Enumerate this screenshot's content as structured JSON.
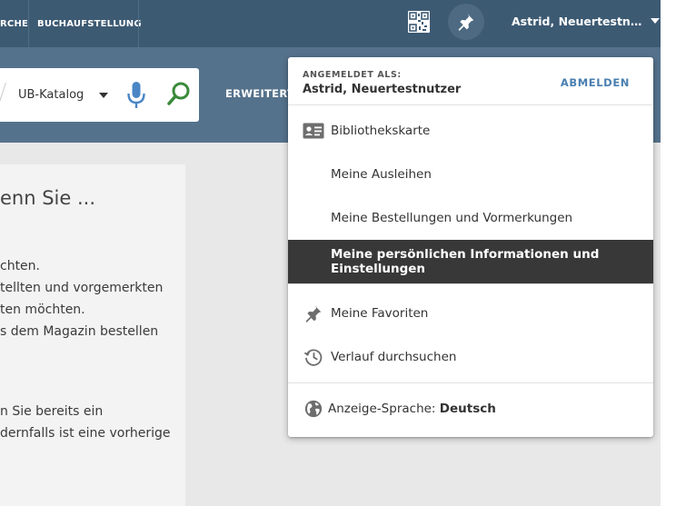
{
  "topbar": {
    "nav_partial": "RCHE",
    "nav_buchaufstellung": "BUCHAUFSTELLUNG",
    "user_name_truncated": "Astrid, Neuertestn…"
  },
  "search": {
    "scope_value": "UB-Katalog",
    "advanced_label": "ERWEITERT"
  },
  "background_panel": {
    "heading_partial": "enn Sie ...",
    "lines": [
      "chten.",
      "tellten und vorgemerkten",
      "ten möchten.",
      "s dem Magazin bestellen",
      "n Sie bereits ein",
      "dernfalls ist eine vorherige"
    ]
  },
  "user_dropdown": {
    "logged_in_label": "ANGEMELDET ALS:",
    "user_name": "Astrid, Neuertestnutzer",
    "logout_label": "ABMELDEN",
    "items": [
      {
        "label": "Bibliothekskarte",
        "icon": "library-card-icon"
      },
      {
        "label": "Meine Ausleihen"
      },
      {
        "label": "Meine Bestellungen und Vormerkungen"
      },
      {
        "label": "Meine persönlichen Informationen und Einstellungen",
        "active": true
      },
      {
        "label": "Meine Favoriten",
        "icon": "pin-icon"
      },
      {
        "label": "Verlauf durchsuchen",
        "icon": "history-icon"
      }
    ],
    "language_label": "Anzeige-Sprache: ",
    "language_value": "Deutsch"
  },
  "colors": {
    "topbar": "#3d5a73",
    "hero": "#55728c",
    "active_item_bg": "#383838",
    "logout_link": "#4a7fb0",
    "search_icon": "#3a8a3a",
    "mic_icon": "#4a86c5"
  }
}
